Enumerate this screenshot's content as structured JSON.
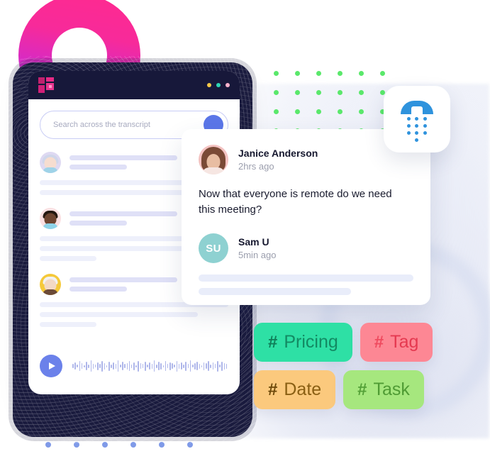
{
  "app_window": {
    "brand_logo_icon": "brand-logo-icon",
    "window_controls": [
      {
        "name": "minimize-dot",
        "color": "#f7c948"
      },
      {
        "name": "maximize-dot",
        "color": "#2fd4b4"
      },
      {
        "name": "close-dot",
        "color": "#ffb3cd"
      }
    ],
    "search": {
      "placeholder": "Search across the transcript",
      "value": "",
      "button_icon": "search-submit-icon"
    },
    "player": {
      "play_icon": "play-icon",
      "waveform_icon": "audio-waveform"
    },
    "transcript_rows": [
      {
        "avatar": "avatar-speaker-one"
      },
      {
        "avatar": "avatar-speaker-two"
      },
      {
        "avatar": "avatar-speaker-three"
      }
    ]
  },
  "comment_card": {
    "primary": {
      "avatar_icon": "avatar-janice-anderson",
      "name": "Janice Anderson",
      "time": "2hrs ago",
      "message": "Now that everyone is remote do we need this meeting?"
    },
    "reply": {
      "initials": "SU",
      "avatar_color": "#8ed1d1",
      "name": "Sam U",
      "time": "5min ago"
    }
  },
  "phone_card": {
    "icon": "phone-dialpad-icon",
    "color": "#2f93dd"
  },
  "tags": [
    {
      "name": "tag-pricing",
      "hash": "#",
      "label": "Pricing",
      "bg": "#2ee0a5",
      "fg": "#138a63"
    },
    {
      "name": "tag-tag",
      "hash": "#",
      "label": "Tag",
      "bg": "#fd8794",
      "fg": "#e53950"
    },
    {
      "name": "tag-date",
      "hash": "#",
      "label": "Date",
      "bg": "#fbc97d",
      "fg": "#8a5f13"
    },
    {
      "name": "tag-task",
      "hash": "#",
      "label": "Task",
      "bg": "#a6e77e",
      "fg": "#4f9b34"
    }
  ],
  "decorations": {
    "donut_gradient_from": "#ff2a8f",
    "donut_gradient_to": "#a72aee",
    "green_dot_color": "#5ae86b",
    "blue_dot_color": "#7f9ae8",
    "dark_panel_color": "#1b1c3f"
  }
}
